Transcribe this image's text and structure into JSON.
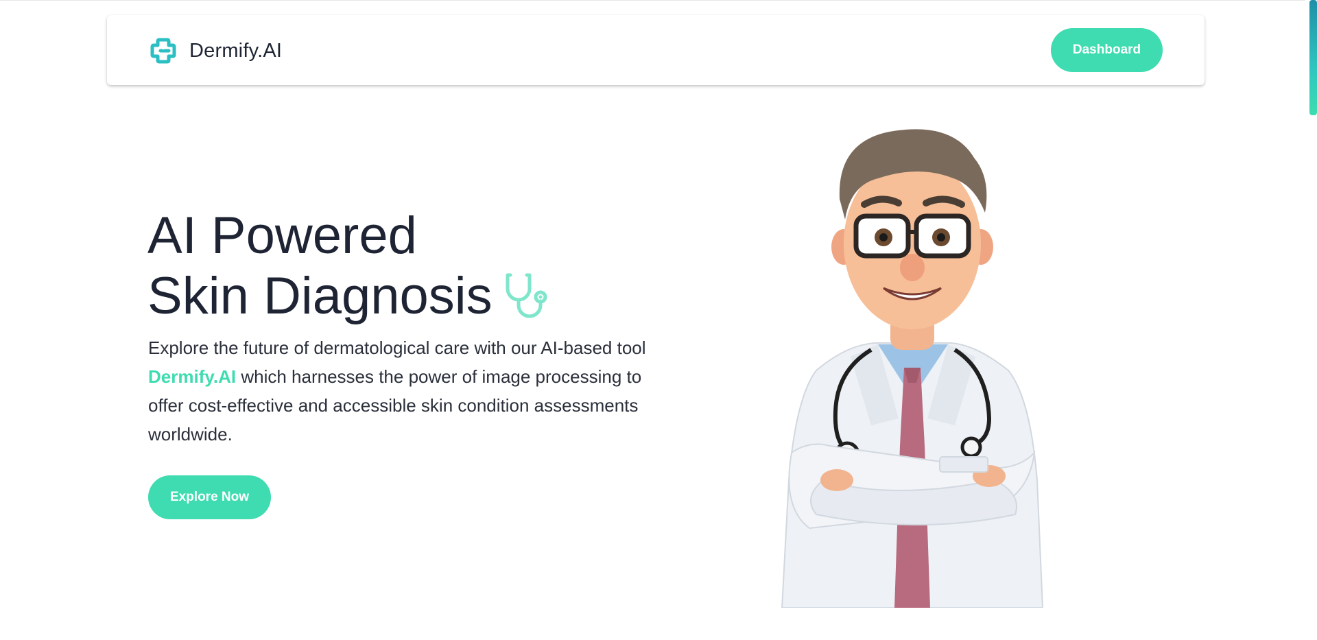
{
  "navbar": {
    "brand_name": "Dermify.AI",
    "logo_icon": "medical-cross-logo-icon",
    "dashboard_label": "Dashboard"
  },
  "hero": {
    "title_line1": "AI Powered",
    "title_line2": "Skin Diagnosis",
    "title_icon": "stethoscope-icon",
    "description_part1": "Explore the future of dermatological care with our AI-based tool ",
    "description_brand": "Dermify.AI",
    "description_part2": " which harnesses the power of image processing to offer cost-effective and accessible skin condition assessments worldwide.",
    "cta_label": "Explore Now"
  },
  "illustration": {
    "subject": "cartoon-doctor-illustration"
  },
  "colors": {
    "accent": "#3edcb0",
    "logo": "#2bbfc4",
    "text_dark": "#1e2433"
  }
}
